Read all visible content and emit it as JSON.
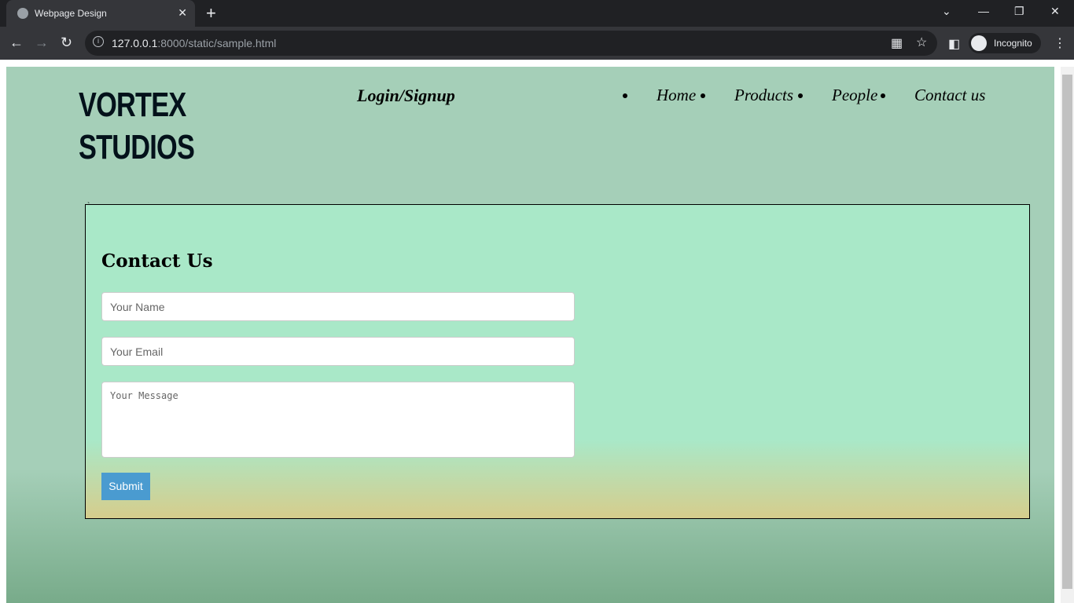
{
  "browser": {
    "tab_title": "Webpage Design",
    "url_host": "127.0.0.1",
    "url_rest": ":8000/static/sample.html",
    "profile": "Incognito"
  },
  "site": {
    "logo_line1": "VORTEX",
    "logo_line2": "STUDIOS",
    "login": "Login/Signup",
    "nav": [
      {
        "label": "Home"
      },
      {
        "label": "Products"
      },
      {
        "label": "People"
      },
      {
        "label": "Contact us"
      }
    ]
  },
  "contact": {
    "title": "Contact Us",
    "name_placeholder": "Your Name",
    "email_placeholder": "Your Email",
    "message_placeholder": "Your Message",
    "submit": "Submit",
    "stray_mark": "`"
  }
}
